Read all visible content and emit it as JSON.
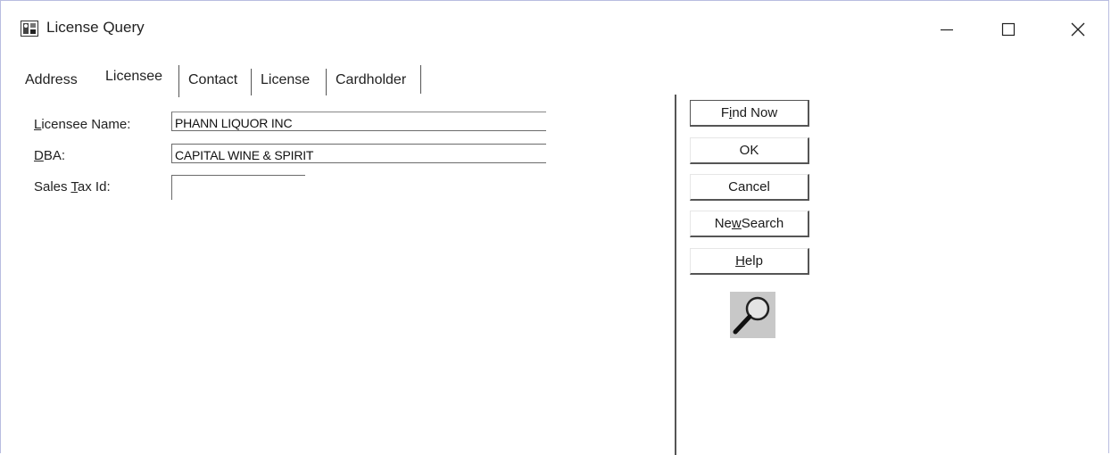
{
  "window": {
    "title": "License Query"
  },
  "tabs": [
    {
      "label": "Address"
    },
    {
      "label": "Licensee"
    },
    {
      "label": "Contact"
    },
    {
      "label": "License"
    },
    {
      "label": "Cardholder"
    }
  ],
  "form": {
    "licensee_name": {
      "label_first": "L",
      "label_rest": "icensee Name:",
      "value": "PHANN LIQUOR INC"
    },
    "dba": {
      "label_first": "D",
      "label_rest": "BA:",
      "value": "CAPITAL WINE & SPIRIT"
    },
    "sales_tax_id": {
      "label_pre": "Sales ",
      "label_first": "T",
      "label_rest": "ax Id:",
      "value": ""
    }
  },
  "buttons": {
    "find_now": {
      "pre": "F",
      "u": "i",
      "post": "nd Now"
    },
    "ok": {
      "label": "OK"
    },
    "cancel": {
      "label": "Cancel"
    },
    "new_search": {
      "pre": "Ne",
      "u": "w",
      "post": " Search"
    },
    "help": {
      "pre": "",
      "u": "H",
      "post": "elp"
    }
  },
  "icons": {
    "app": "license-query-app-icon",
    "search": "magnifying-glass-icon"
  }
}
